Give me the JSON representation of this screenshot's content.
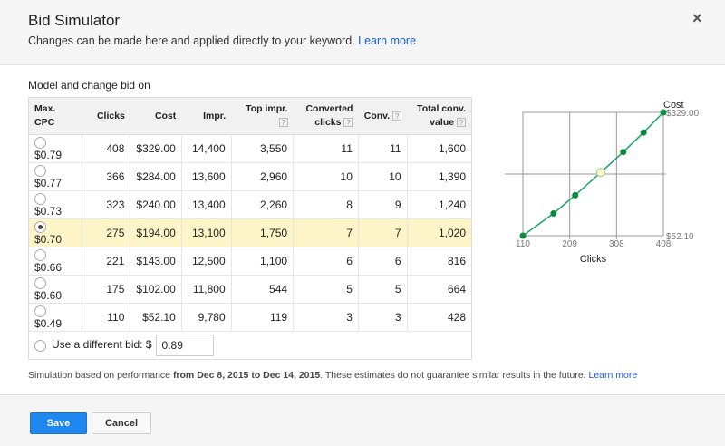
{
  "header": {
    "title": "Bid Simulator",
    "subtitle": "Changes can be made here and applied directly to your keyword.",
    "learn_more": "Learn more",
    "close": "×"
  },
  "model_label": "Model and change bid on",
  "columns": [
    "Max. CPC",
    "Clicks",
    "Cost",
    "Impr.",
    "Top impr.",
    "Converted clicks",
    "Conv.",
    "Total conv. value"
  ],
  "help": "?",
  "rows": [
    {
      "cpc": "$0.79",
      "clicks": "408",
      "cost": "$329.00",
      "impr": "14,400",
      "top": "3,550",
      "cc": "11",
      "conv": "11",
      "value": "1,600"
    },
    {
      "cpc": "$0.77",
      "clicks": "366",
      "cost": "$284.00",
      "impr": "13,600",
      "top": "2,960",
      "cc": "10",
      "conv": "10",
      "value": "1,390"
    },
    {
      "cpc": "$0.73",
      "clicks": "323",
      "cost": "$240.00",
      "impr": "13,400",
      "top": "2,260",
      "cc": "8",
      "conv": "9",
      "value": "1,240"
    },
    {
      "cpc": "$0.70",
      "clicks": "275",
      "cost": "$194.00",
      "impr": "13,100",
      "top": "1,750",
      "cc": "7",
      "conv": "7",
      "value": "1,020"
    },
    {
      "cpc": "$0.66",
      "clicks": "221",
      "cost": "$143.00",
      "impr": "12,500",
      "top": "1,100",
      "cc": "6",
      "conv": "6",
      "value": "816"
    },
    {
      "cpc": "$0.60",
      "clicks": "175",
      "cost": "$102.00",
      "impr": "11,800",
      "top": "544",
      "cc": "5",
      "conv": "5",
      "value": "664"
    },
    {
      "cpc": "$0.49",
      "clicks": "110",
      "cost": "$52.10",
      "impr": "9,780",
      "top": "119",
      "cc": "3",
      "conv": "3",
      "value": "428"
    }
  ],
  "selected_index": 3,
  "different_bid": {
    "label": "Use a different bid: $",
    "value": "0.89"
  },
  "note": {
    "pre": "Simulation based on performance ",
    "range": "from Dec 8, 2015 to Dec 14, 2015",
    "post": ". These estimates do not guarantee similar results in the future.",
    "link": "Learn more"
  },
  "footer": {
    "save": "Save",
    "cancel": "Cancel"
  },
  "chart_data": {
    "type": "line",
    "xlabel": "Clicks",
    "ylabel": "Cost",
    "x_ticks": [
      "110",
      "209",
      "308",
      "408"
    ],
    "y_ticks": [
      "$52.10",
      "$329.00"
    ],
    "xlim": [
      110,
      408
    ],
    "ylim": [
      52.1,
      329
    ],
    "x": [
      110,
      175,
      221,
      275,
      323,
      366,
      408
    ],
    "y": [
      52.1,
      102,
      143,
      194,
      240,
      284,
      329
    ],
    "highlight_index": 3,
    "line_color": "#1aa36b",
    "point_color": "#0a8a3a",
    "highlight_color": "#fdf5c8"
  }
}
